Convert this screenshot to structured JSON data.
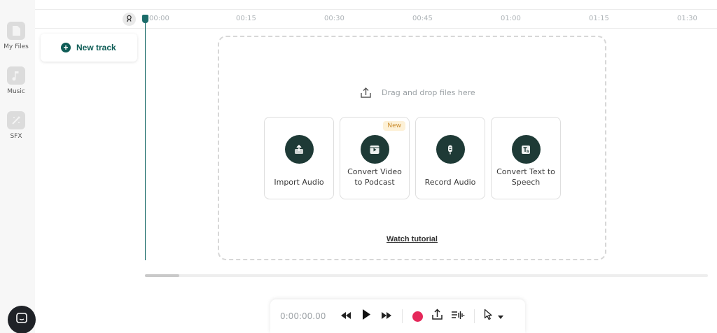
{
  "sidebar": {
    "items": [
      {
        "label": "My Files",
        "icon": "file-icon"
      },
      {
        "label": "Music",
        "icon": "music-note-icon"
      },
      {
        "label": "SFX",
        "icon": "magic-wand-icon"
      }
    ]
  },
  "timeline": {
    "ticks": [
      "00:00",
      "00:15",
      "00:30",
      "00:45",
      "01:00",
      "01:15",
      "01:30"
    ]
  },
  "track": {
    "new_track_label": "New track"
  },
  "dropzone": {
    "hint": "Drag and drop files here",
    "cards": [
      {
        "label": "Import Audio",
        "icon": "upload-icon"
      },
      {
        "label": "Convert Video to Podcast",
        "icon": "video-icon",
        "badge": "New"
      },
      {
        "label": "Record Audio",
        "icon": "microphone-icon"
      },
      {
        "label": "Convert Text to Speech",
        "icon": "text-to-speech-icon"
      }
    ],
    "watch_tutorial": "Watch tutorial"
  },
  "transport": {
    "time": "0:00:00.00"
  },
  "colors": {
    "accent": "#0f5d57",
    "playhead": "#1b6c6a",
    "record": "#e5285a",
    "card_icon_bg": "#1e3a36",
    "badge_bg": "#fdf1d7",
    "badge_text": "#c98a2a"
  }
}
